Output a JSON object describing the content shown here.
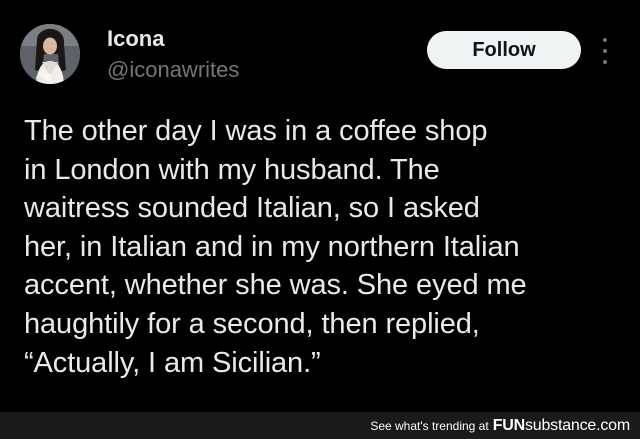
{
  "author": {
    "display_name": "Icona",
    "handle": "@iconawrites"
  },
  "actions": {
    "follow_label": "Follow"
  },
  "tweet": {
    "lines": [
      "The other day I was in a coffee shop",
      "in London with my husband. The",
      "waitress sounded Italian, so I asked",
      "her, in Italian and in my northern Italian",
      "accent, whether she was. She eyed me",
      "haughtily for a second, then replied,",
      "“Actually, I am Sicilian.”"
    ]
  },
  "footer": {
    "trending_label": "See what's trending at",
    "brand_bold": "FUN",
    "brand_rest": "substance.com"
  },
  "colors": {
    "background": "#000000",
    "primary_text": "#e7e9ea",
    "secondary_text": "#71767b",
    "follow_button_bg": "#eff3f4",
    "follow_button_text": "#0f1419",
    "footer_bg": "#1a1a1a"
  },
  "icons": {
    "more": "vertical-ellipsis"
  }
}
